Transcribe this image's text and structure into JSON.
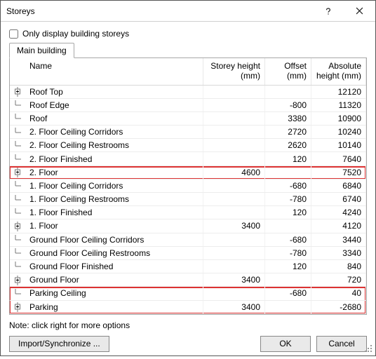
{
  "window": {
    "title": "Storeys"
  },
  "checkbox": {
    "label": "Only display building storeys",
    "checked": false
  },
  "tabs": [
    {
      "label": "Main building"
    }
  ],
  "columns": {
    "name": "Name",
    "storey_height": "Storey height (mm)",
    "offset": "Offset (mm)",
    "abs_height": "Absolute height (mm)"
  },
  "rows": [
    {
      "icon": "plus",
      "name": "Roof Top",
      "storey_height": "",
      "offset": "",
      "abs": "12120",
      "hl": ""
    },
    {
      "icon": "child",
      "name": "Roof Edge",
      "storey_height": "",
      "offset": "-800",
      "abs": "11320",
      "hl": ""
    },
    {
      "icon": "child",
      "name": "Roof",
      "storey_height": "",
      "offset": "3380",
      "abs": "10900",
      "hl": ""
    },
    {
      "icon": "child",
      "name": "2. Floor Ceiling Corridors",
      "storey_height": "",
      "offset": "2720",
      "abs": "10240",
      "hl": ""
    },
    {
      "icon": "child",
      "name": "2. Floor Ceiling Restrooms",
      "storey_height": "",
      "offset": "2620",
      "abs": "10140",
      "hl": ""
    },
    {
      "icon": "child",
      "name": "2. Floor Finished",
      "storey_height": "",
      "offset": "120",
      "abs": "7640",
      "hl": ""
    },
    {
      "icon": "plus",
      "name": "2. Floor",
      "storey_height": "4600",
      "offset": "",
      "abs": "7520",
      "hl": "single"
    },
    {
      "icon": "child",
      "name": "1. Floor Ceiling Corridors",
      "storey_height": "",
      "offset": "-680",
      "abs": "6840",
      "hl": ""
    },
    {
      "icon": "child",
      "name": "1. Floor Ceiling Restrooms",
      "storey_height": "",
      "offset": "-780",
      "abs": "6740",
      "hl": ""
    },
    {
      "icon": "child",
      "name": "1. Floor Finished",
      "storey_height": "",
      "offset": "120",
      "abs": "4240",
      "hl": ""
    },
    {
      "icon": "plus",
      "name": "1. Floor",
      "storey_height": "3400",
      "offset": "",
      "abs": "4120",
      "hl": ""
    },
    {
      "icon": "child",
      "name": "Ground Floor Ceiling Corridors",
      "storey_height": "",
      "offset": "-680",
      "abs": "3440",
      "hl": ""
    },
    {
      "icon": "child",
      "name": "Ground Floor Ceiling Restrooms",
      "storey_height": "",
      "offset": "-780",
      "abs": "3340",
      "hl": ""
    },
    {
      "icon": "child",
      "name": "Ground Floor Finished",
      "storey_height": "",
      "offset": "120",
      "abs": "840",
      "hl": ""
    },
    {
      "icon": "plus",
      "name": "Ground Floor",
      "storey_height": "3400",
      "offset": "",
      "abs": "720",
      "hl": ""
    },
    {
      "icon": "child",
      "name": "Parking Ceiling",
      "storey_height": "",
      "offset": "-680",
      "abs": "40",
      "hl": "top"
    },
    {
      "icon": "plus",
      "name": "Parking",
      "storey_height": "3400",
      "offset": "",
      "abs": "-2680",
      "hl": "bot"
    }
  ],
  "note": "Note: click right for more options",
  "buttons": {
    "import": "Import/Synchronize ...",
    "ok": "OK",
    "cancel": "Cancel"
  },
  "highlight_color": "#d33"
}
